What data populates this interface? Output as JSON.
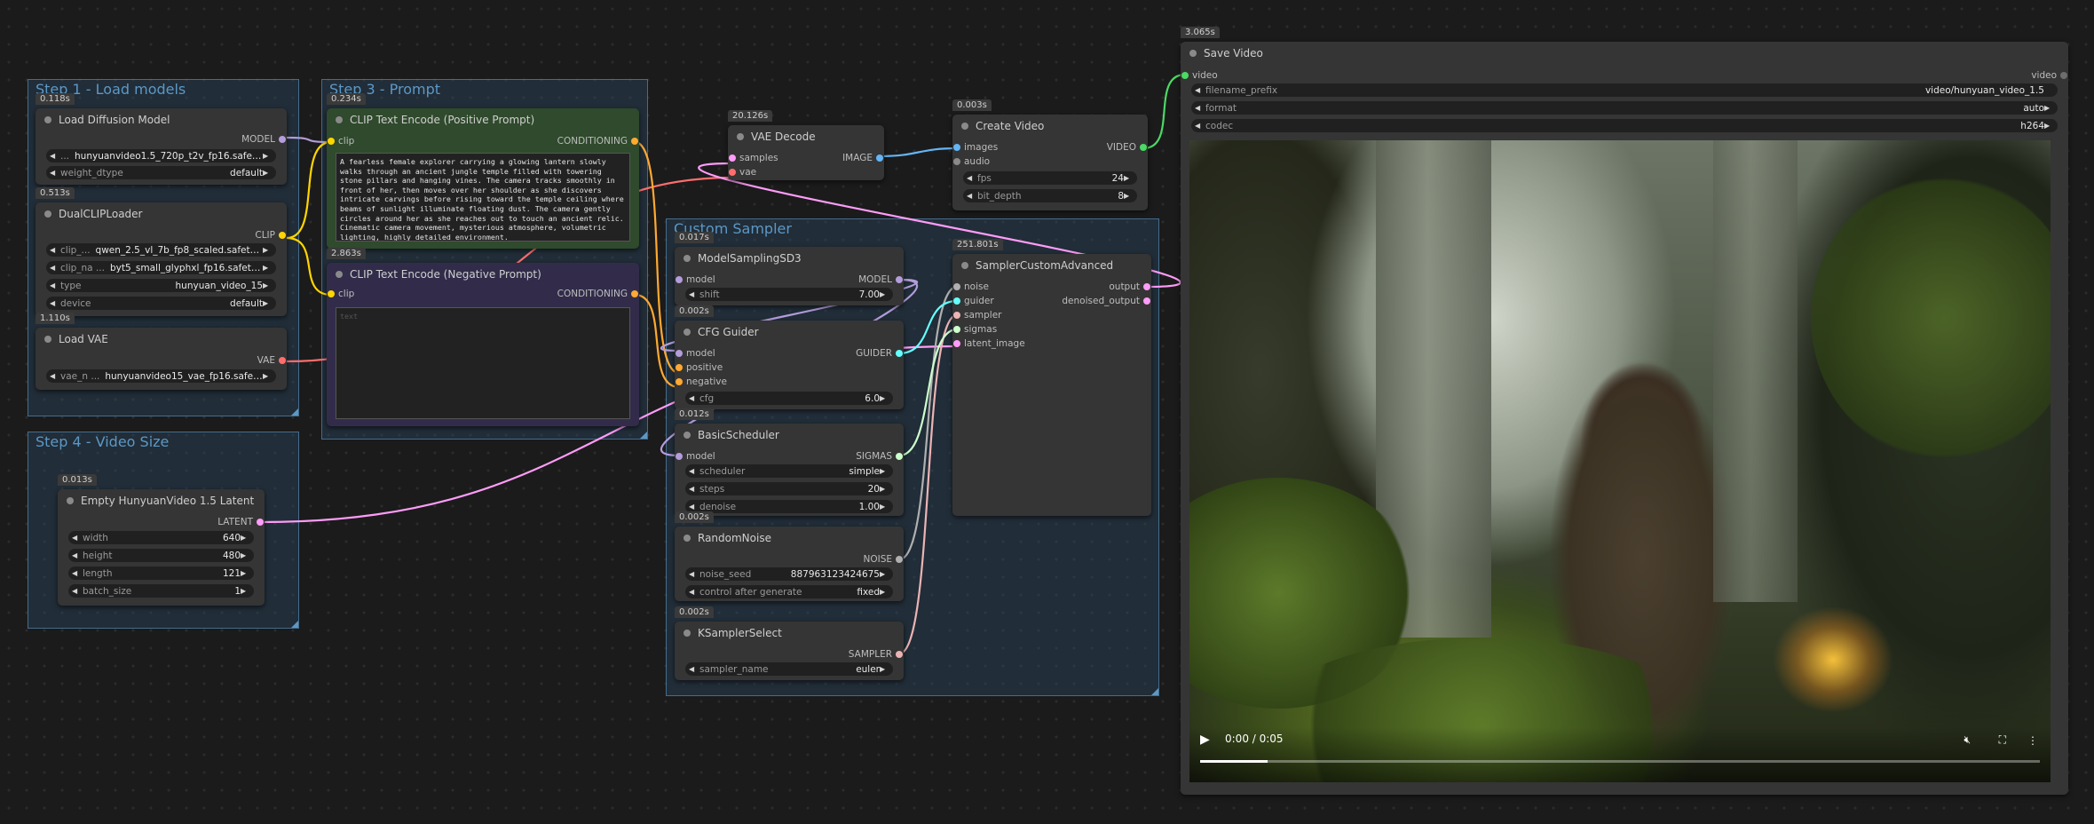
{
  "groups": {
    "load_models": "Step 1 - Load models",
    "prompt": "Step 3 - Prompt",
    "video_size": "Step 4 - Video Size",
    "custom_sampler": "Custom Sampler"
  },
  "nodes": {
    "load_diffusion": {
      "timing": "0.118s",
      "title": "Load Diffusion Model",
      "out": "MODEL",
      "unet_label": "...",
      "unet_value": "hunyuanvideo1.5_720p_t2v_fp16.safetensors",
      "dtype_label": "weight_dtype",
      "dtype_value": "default"
    },
    "dual_clip": {
      "timing": "0.513s",
      "title": "DualCLIPLoader",
      "out": "CLIP",
      "clip1_label": "clip_...",
      "clip1_value": "qwen_2.5_vl_7b_fp8_scaled.safetensors",
      "clip2_label": "clip_na ...",
      "clip2_value": "byt5_small_glyphxl_fp16.safetensors",
      "type_label": "type",
      "type_value": "hunyuan_video_15",
      "device_label": "device",
      "device_value": "default"
    },
    "load_vae": {
      "timing": "1.110s",
      "title": "Load VAE",
      "out": "VAE",
      "vae_label": "vae_n ...",
      "vae_value": "hunyuanvideo15_vae_fp16.safetensors"
    },
    "clip_pos": {
      "timing": "0.234s",
      "title": "CLIP Text Encode (Positive Prompt)",
      "in": "clip",
      "out": "CONDITIONING",
      "text": "A fearless female explorer carrying a glowing lantern slowly walks through an ancient jungle temple filled with towering stone pillars and hanging vines. The camera tracks smoothly in front of her, then moves over her shoulder as she discovers intricate carvings before rising toward the temple ceiling where beams of sunlight illuminate floating dust. The camera gently circles around her as she reaches out to touch an ancient relic. Cinematic camera movement, mysterious atmosphere, volumetric lighting, highly detailed environment."
    },
    "clip_neg": {
      "timing": "2.863s",
      "title": "CLIP Text Encode (Negative Prompt)",
      "in": "clip",
      "out": "CONDITIONING",
      "placeholder": "text"
    },
    "empty_latent": {
      "timing": "0.013s",
      "title": "Empty HunyuanVideo 1.5 Latent",
      "out": "LATENT",
      "width_label": "width",
      "width": "640",
      "height_label": "height",
      "height": "480",
      "length_label": "length",
      "length": "121",
      "batch_label": "batch_size",
      "batch": "1"
    },
    "vae_decode": {
      "timing": "20.126s",
      "title": "VAE Decode",
      "in1": "samples",
      "in2": "vae",
      "out": "IMAGE"
    },
    "create_video": {
      "timing": "0.003s",
      "title": "Create Video",
      "in1": "images",
      "in2": "audio",
      "out": "VIDEO",
      "fps_label": "fps",
      "fps": "24",
      "bit_label": "bit_depth",
      "bit": "8"
    },
    "model_sampling": {
      "timing": "0.017s",
      "title": "ModelSamplingSD3",
      "in": "model",
      "out": "MODEL",
      "shift_label": "shift",
      "shift": "7.00"
    },
    "cfg_guider": {
      "timing": "0.002s",
      "title": "CFG Guider",
      "in1": "model",
      "in2": "positive",
      "in3": "negative",
      "out": "GUIDER",
      "cfg_label": "cfg",
      "cfg": "6.0"
    },
    "basic_scheduler": {
      "timing": "0.012s",
      "title": "BasicScheduler",
      "in": "model",
      "out": "SIGMAS",
      "sched_label": "scheduler",
      "sched": "simple",
      "steps_label": "steps",
      "steps": "20",
      "denoise_label": "denoise",
      "denoise": "1.00"
    },
    "random_noise": {
      "timing": "0.002s",
      "title": "RandomNoise",
      "out": "NOISE",
      "seed_label": "noise_seed",
      "seed": "887963123424675",
      "ctrl_label": "control after generate",
      "ctrl": "fixed"
    },
    "ksampler_select": {
      "timing": "0.002s",
      "title": "KSamplerSelect",
      "out": "SAMPLER",
      "name_label": "sampler_name",
      "name": "euler"
    },
    "sampler_adv": {
      "timing": "251.801s",
      "title": "SamplerCustomAdvanced",
      "in1": "noise",
      "in2": "guider",
      "in3": "sampler",
      "in4": "sigmas",
      "in5": "latent_image",
      "out1": "output",
      "out2": "denoised_output"
    },
    "save_video": {
      "timing": "3.065s",
      "title": "Save Video",
      "in": "video",
      "out": "video",
      "prefix_label": "filename_prefix",
      "prefix": "video/hunyuan_video_1.5",
      "format_label": "format",
      "format": "auto",
      "codec_label": "codec",
      "codec": "h264"
    }
  },
  "player": {
    "time": "0:00 / 0:05",
    "progress": 0.08
  },
  "colors": {
    "model": "#b39ddb",
    "clip": "#ffd500",
    "vae": "#ff6e6e",
    "conditioning": "#ffa931",
    "latent": "#ff9cf9",
    "image": "#64b5f6",
    "video": "#4cd964",
    "guider": "#66ffff",
    "sigmas": "#cdffcd",
    "noise": "#b0b0b0",
    "sampler": "#ecb4b4"
  }
}
